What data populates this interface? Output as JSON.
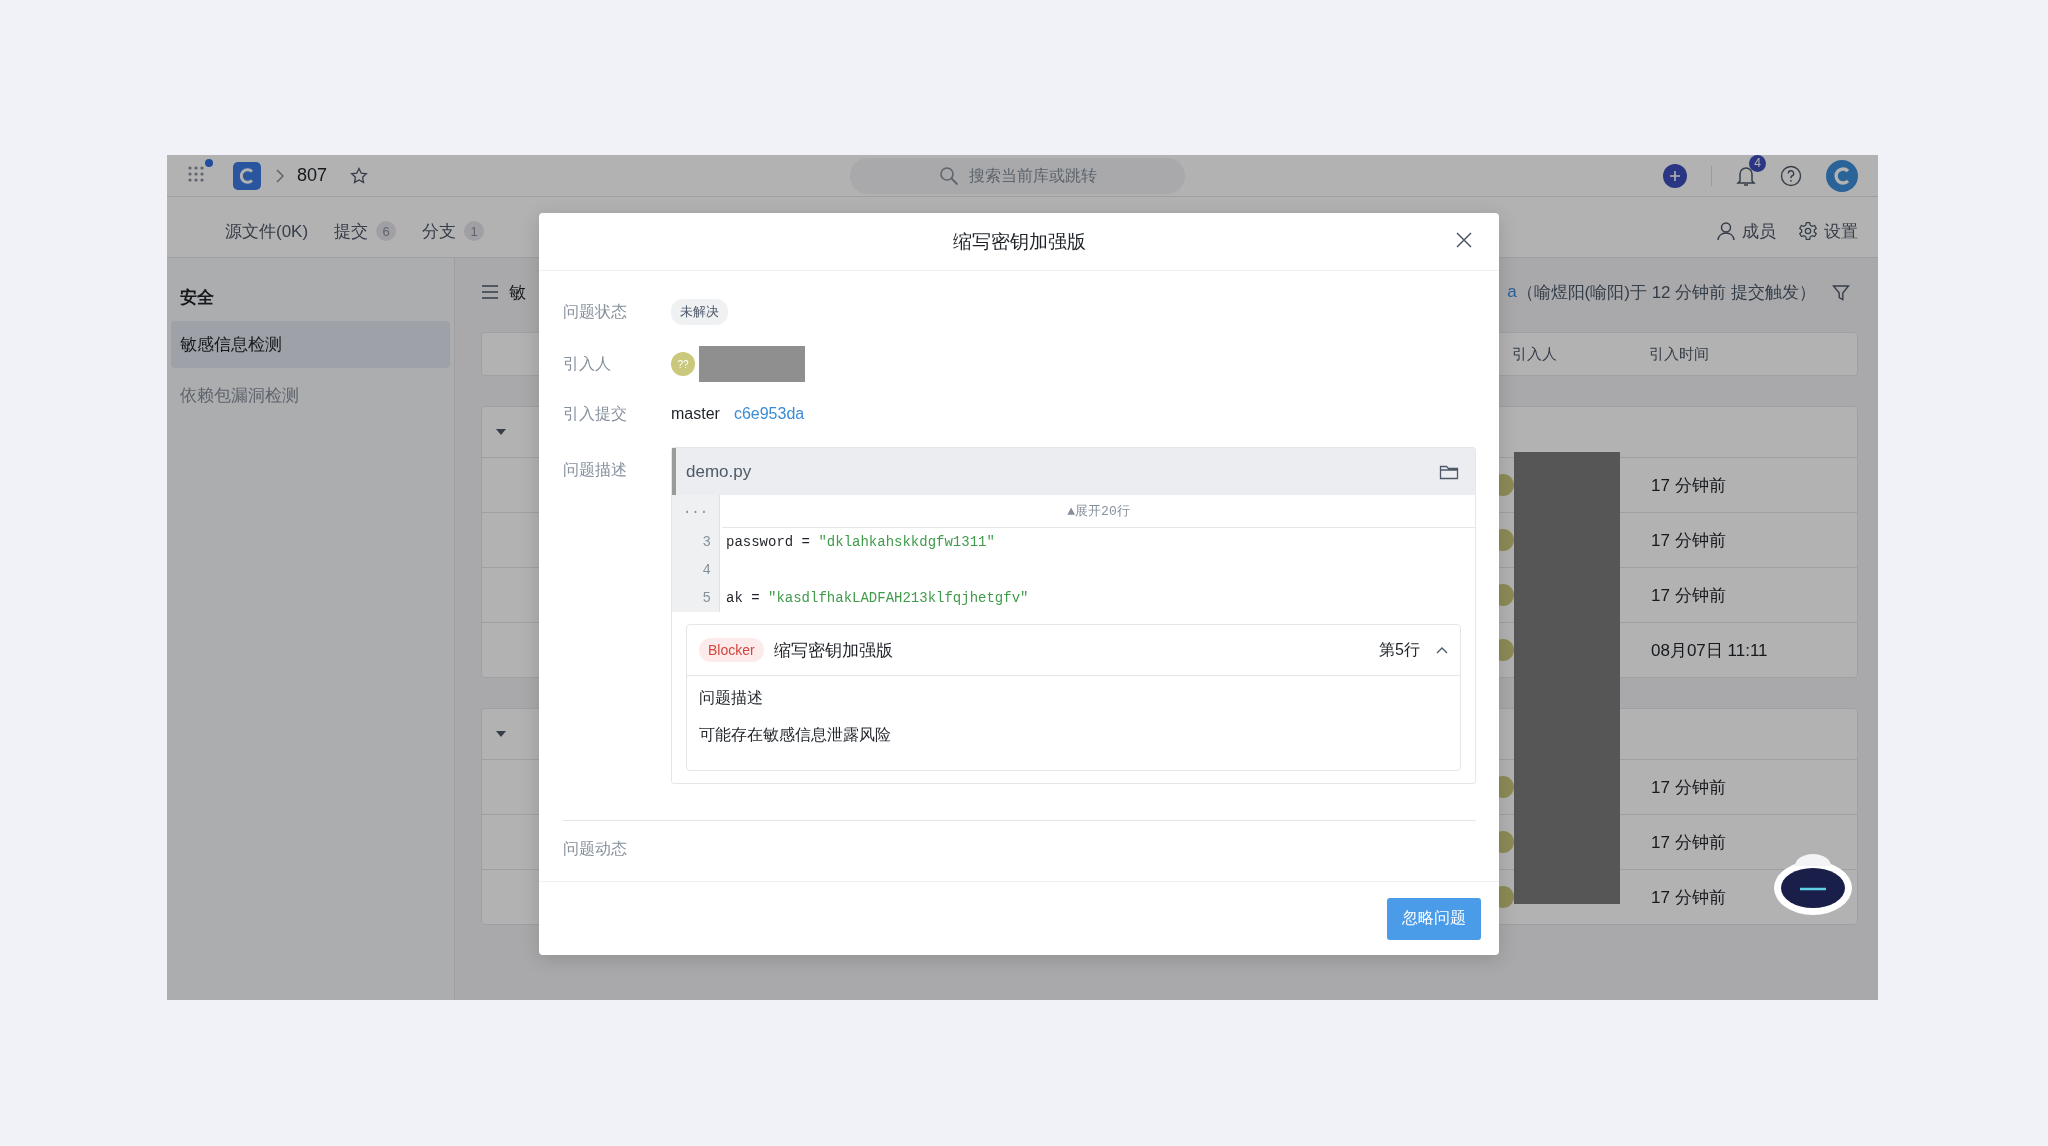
{
  "topbar": {
    "repo": "807",
    "search": {
      "placeholder": "搜索当前库或跳转"
    },
    "notification_count": "4"
  },
  "tabs": [
    {
      "label": "源文件(0K)"
    },
    {
      "label": "提交",
      "count": "6"
    },
    {
      "label": "分支",
      "count": "1"
    }
  ],
  "header_actions": [
    {
      "kind": "members",
      "label": "成员"
    },
    {
      "kind": "settings",
      "label": "设置"
    }
  ],
  "sidebar": {
    "title": "安全",
    "items": [
      {
        "label": "敏感信息检测",
        "selected": true
      },
      {
        "label": "依赖包漏洞检测",
        "selected": false
      }
    ]
  },
  "content": {
    "title": "敏",
    "trigger_link": "a",
    "trigger_text": "（喻煜阳(喻阳)于 12 分钟前 提交触发）",
    "columns": [
      "引入人",
      "引入时间"
    ],
    "groups": [
      {
        "expanded": true,
        "rows": [
          {
            "time": "17 分钟前"
          },
          {
            "time": "17 分钟前"
          },
          {
            "time": "17 分钟前"
          },
          {
            "time": "08月07日 11:11"
          }
        ]
      },
      {
        "expanded": true,
        "rows": [
          {
            "time": "17 分钟前"
          },
          {
            "time": "17 分钟前"
          },
          {
            "time": "17 分钟前"
          }
        ]
      }
    ]
  },
  "modal": {
    "title": "缩写密钥加强版",
    "status_label": "问题状态",
    "status": "未解决",
    "introducer_label": "引入人",
    "avatar_text": "??",
    "commit_label": "引入提交",
    "branch": "master",
    "commit": "c6e953da",
    "description_label": "问题描述",
    "code": {
      "file": "demo.py",
      "gutter": "···",
      "expand": "▲展开20行",
      "lines": [
        {
          "number": "3",
          "code": "password = ",
          "string": "\"dklahkahskkdgfw1311\""
        },
        {
          "number": "4"
        },
        {
          "number": "5",
          "code": "ak = ",
          "string": "\"kasdlfhakLADFAH213klfqjhetgfv\""
        }
      ]
    },
    "issue": {
      "severity": "Blocker",
      "title": "缩写密钥加强版",
      "line": "第5行",
      "expanded": true,
      "body_title": "问题描述",
      "body_text": "可能存在敏感信息泄露风险"
    },
    "activity_label": "问题动态",
    "button": "忽略问题"
  }
}
